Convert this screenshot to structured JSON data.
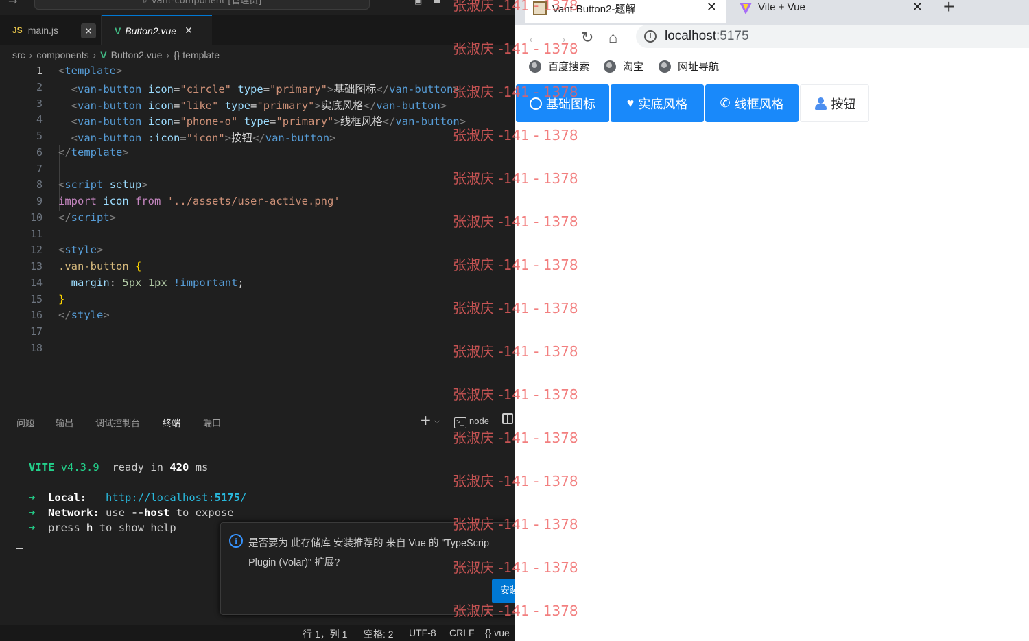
{
  "vscode": {
    "title": "vant-component [管理员]",
    "tabs": [
      {
        "icon": "JS",
        "label": "main.js",
        "close": "✕"
      },
      {
        "icon": "V",
        "label": "Button2.vue",
        "close": "✕"
      }
    ],
    "breadcrumb": [
      "src",
      "components",
      "Button2.vue",
      "{} template"
    ],
    "line_numbers": [
      "1",
      "2",
      "3",
      "4",
      "5",
      "6",
      "7",
      "8",
      "9",
      "10",
      "11",
      "12",
      "13",
      "14",
      "15",
      "16",
      "17",
      "18"
    ],
    "active_line": 1,
    "panel_tabs": [
      "问题",
      "输出",
      "调试控制台",
      "终端",
      "端口"
    ],
    "active_panel_tab": "终端",
    "terminal_profile": "node",
    "terminal": {
      "vite": "VITE",
      "version": "v4.3.9",
      "ready": "ready in",
      "ms": "420",
      "ms_unit": "ms",
      "local_label": "Local",
      "local_url_prefix": "http://localhost:",
      "local_url_port": "5175",
      "local_url_suffix": "/",
      "network_label": "Network",
      "network_text_a": "use",
      "network_text_b": "--host",
      "network_text_c": "to expose",
      "help_a": "press",
      "help_b": "h",
      "help_c": "to show help"
    },
    "notification": {
      "message": "是否要为 此存储库 安装推荐的 来自 Vue 的 \"TypeScript Vue Plugin (Volar)\" 扩展?",
      "line1": "是否要为 此存储库 安装推荐的 来自 Vue 的 \"TypeScrip",
      "line2": "Plugin (Volar)\" 扩展?",
      "install": "安装"
    },
    "status": {
      "position": "行 1，列 1",
      "spaces": "空格: 2",
      "encoding": "UTF-8",
      "eol": "CRLF",
      "language": "{} vue"
    }
  },
  "browser": {
    "tabs": [
      {
        "title": "Vant-Button2-题解",
        "close": "✕"
      },
      {
        "title": "Vite + Vue",
        "close": "✕"
      }
    ],
    "new_tab": "+",
    "url_host": "localhost",
    "url_port": ":5175",
    "bookmarks": [
      "百度搜索",
      "淘宝",
      "网址导航"
    ],
    "buttons": [
      {
        "label": "基础图标",
        "icon": "circle-icon",
        "type": "primary"
      },
      {
        "label": "实底风格",
        "icon": "like-icon",
        "type": "primary"
      },
      {
        "label": "线框风格",
        "icon": "phone-o-icon",
        "type": "primary"
      },
      {
        "label": "按钮",
        "icon": "user-active-icon",
        "type": "default"
      }
    ]
  },
  "watermark": {
    "text": "张淑庆 -141 - 1378",
    "count": 15
  },
  "colors": {
    "vscode_bg": "#1f1f1f",
    "vant_primary": "#1989fa",
    "watermark": "#f06060",
    "terminal_green": "#23d18b",
    "accent_blue": "#0078d4"
  }
}
